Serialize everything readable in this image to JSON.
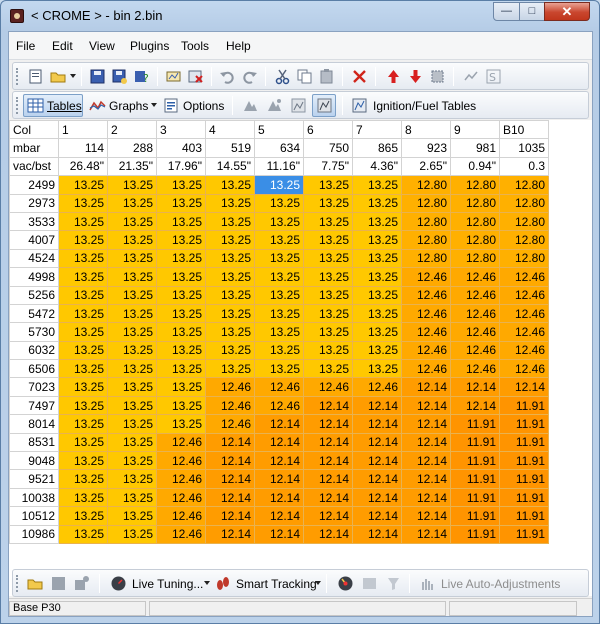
{
  "window": {
    "title": "< CROME > - bin 2.bin",
    "minimize": "—",
    "maximize": "□",
    "close": "✕"
  },
  "menu": [
    "File",
    "Edit",
    "View",
    "Plugins",
    "Tools",
    "Help"
  ],
  "toolbar2": {
    "tables": "Tables",
    "graphs": "Graphs",
    "options": "Options",
    "ignition_fuel": "Ignition/Fuel Tables"
  },
  "table": {
    "col_label": "Col",
    "columns": [
      "1",
      "2",
      "3",
      "4",
      "5",
      "6",
      "7",
      "8",
      "9",
      "B10"
    ],
    "mbar_label": "mbar",
    "mbar": [
      "114",
      "288",
      "403",
      "519",
      "634",
      "750",
      "865",
      "923",
      "981",
      "1035"
    ],
    "vac_label": "vac/bst",
    "vac": [
      "26.48\"",
      "21.35\"",
      "17.96\"",
      "14.55\"",
      "11.16\"",
      "7.75\"",
      "4.36\"",
      "2.65\"",
      "0.94\"",
      "0.3"
    ],
    "selected": {
      "row": 0,
      "col": 4
    },
    "colors": {
      "13.25": "#ffc800",
      "12.80": "#ffb000",
      "12.46": "#ffa900",
      "12.14": "#ff9c00",
      "11.91": "#ff9400"
    },
    "rows": [
      {
        "rpm": "2499",
        "values": [
          "13.25",
          "13.25",
          "13.25",
          "13.25",
          "13.25",
          "13.25",
          "13.25",
          "12.80",
          "12.80",
          "12.80"
        ]
      },
      {
        "rpm": "2973",
        "values": [
          "13.25",
          "13.25",
          "13.25",
          "13.25",
          "13.25",
          "13.25",
          "13.25",
          "12.80",
          "12.80",
          "12.80"
        ]
      },
      {
        "rpm": "3533",
        "values": [
          "13.25",
          "13.25",
          "13.25",
          "13.25",
          "13.25",
          "13.25",
          "13.25",
          "12.80",
          "12.80",
          "12.80"
        ]
      },
      {
        "rpm": "4007",
        "values": [
          "13.25",
          "13.25",
          "13.25",
          "13.25",
          "13.25",
          "13.25",
          "13.25",
          "12.80",
          "12.80",
          "12.80"
        ]
      },
      {
        "rpm": "4524",
        "values": [
          "13.25",
          "13.25",
          "13.25",
          "13.25",
          "13.25",
          "13.25",
          "13.25",
          "12.80",
          "12.80",
          "12.80"
        ]
      },
      {
        "rpm": "4998",
        "values": [
          "13.25",
          "13.25",
          "13.25",
          "13.25",
          "13.25",
          "13.25",
          "13.25",
          "12.46",
          "12.46",
          "12.46"
        ]
      },
      {
        "rpm": "5256",
        "values": [
          "13.25",
          "13.25",
          "13.25",
          "13.25",
          "13.25",
          "13.25",
          "13.25",
          "12.46",
          "12.46",
          "12.46"
        ]
      },
      {
        "rpm": "5472",
        "values": [
          "13.25",
          "13.25",
          "13.25",
          "13.25",
          "13.25",
          "13.25",
          "13.25",
          "12.46",
          "12.46",
          "12.46"
        ]
      },
      {
        "rpm": "5730",
        "values": [
          "13.25",
          "13.25",
          "13.25",
          "13.25",
          "13.25",
          "13.25",
          "13.25",
          "12.46",
          "12.46",
          "12.46"
        ]
      },
      {
        "rpm": "6032",
        "values": [
          "13.25",
          "13.25",
          "13.25",
          "13.25",
          "13.25",
          "13.25",
          "13.25",
          "12.46",
          "12.46",
          "12.46"
        ]
      },
      {
        "rpm": "6506",
        "values": [
          "13.25",
          "13.25",
          "13.25",
          "13.25",
          "13.25",
          "13.25",
          "13.25",
          "12.46",
          "12.46",
          "12.46"
        ]
      },
      {
        "rpm": "7023",
        "values": [
          "13.25",
          "13.25",
          "13.25",
          "12.46",
          "12.46",
          "12.46",
          "12.46",
          "12.14",
          "12.14",
          "12.14"
        ]
      },
      {
        "rpm": "7497",
        "values": [
          "13.25",
          "13.25",
          "13.25",
          "12.46",
          "12.46",
          "12.14",
          "12.14",
          "12.14",
          "12.14",
          "11.91"
        ]
      },
      {
        "rpm": "8014",
        "values": [
          "13.25",
          "13.25",
          "13.25",
          "12.46",
          "12.14",
          "12.14",
          "12.14",
          "12.14",
          "11.91",
          "11.91"
        ]
      },
      {
        "rpm": "8531",
        "values": [
          "13.25",
          "13.25",
          "12.46",
          "12.14",
          "12.14",
          "12.14",
          "12.14",
          "12.14",
          "11.91",
          "11.91"
        ]
      },
      {
        "rpm": "9048",
        "values": [
          "13.25",
          "13.25",
          "12.46",
          "12.14",
          "12.14",
          "12.14",
          "12.14",
          "12.14",
          "11.91",
          "11.91"
        ]
      },
      {
        "rpm": "9521",
        "values": [
          "13.25",
          "13.25",
          "12.46",
          "12.14",
          "12.14",
          "12.14",
          "12.14",
          "12.14",
          "11.91",
          "11.91"
        ]
      },
      {
        "rpm": "10038",
        "values": [
          "13.25",
          "13.25",
          "12.46",
          "12.14",
          "12.14",
          "12.14",
          "12.14",
          "12.14",
          "11.91",
          "11.91"
        ]
      },
      {
        "rpm": "10512",
        "values": [
          "13.25",
          "13.25",
          "12.46",
          "12.14",
          "12.14",
          "12.14",
          "12.14",
          "12.14",
          "11.91",
          "11.91"
        ]
      },
      {
        "rpm": "10986",
        "values": [
          "13.25",
          "13.25",
          "12.46",
          "12.14",
          "12.14",
          "12.14",
          "12.14",
          "12.14",
          "11.91",
          "11.91"
        ]
      }
    ]
  },
  "bottombar": {
    "live_tuning": "Live Tuning...",
    "smart_tracking": "Smart Tracking",
    "live_auto": "Live Auto-Adjustments"
  },
  "status": {
    "base": "Base P30"
  }
}
